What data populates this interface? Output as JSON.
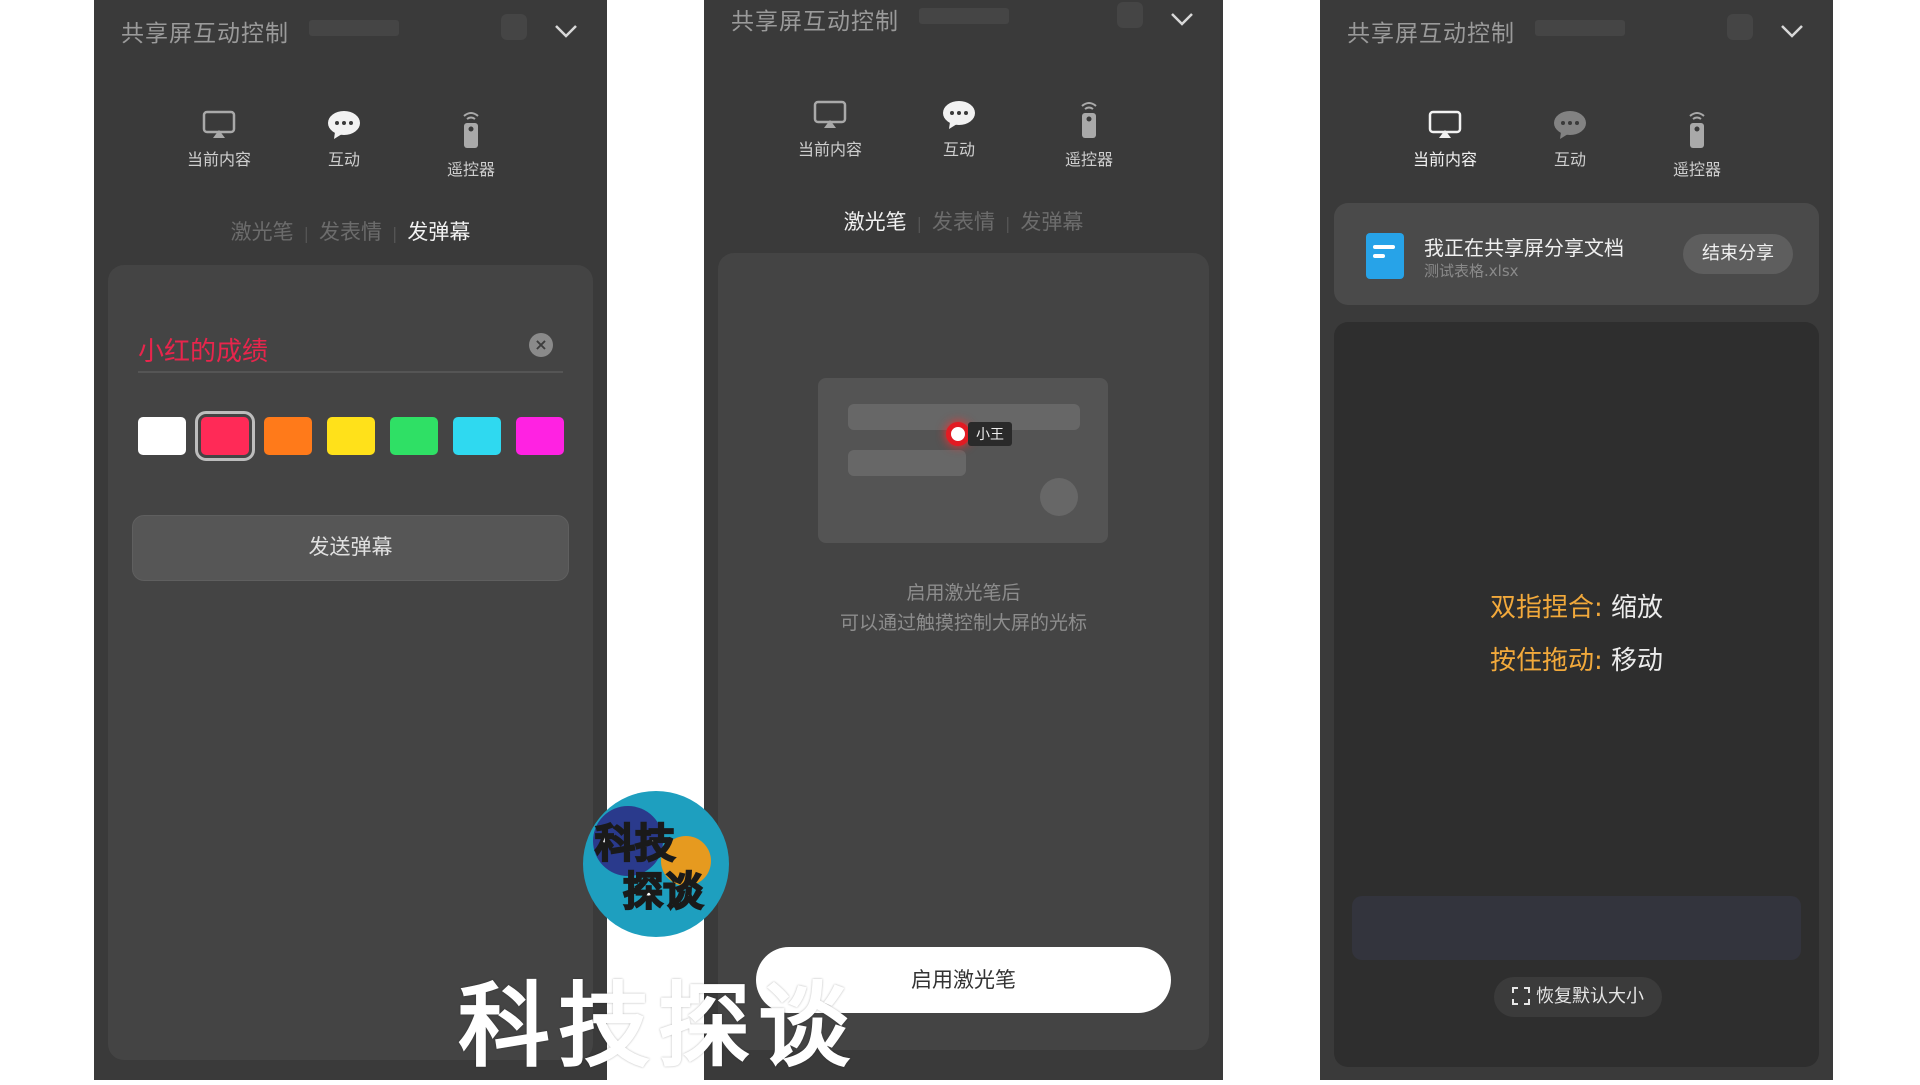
{
  "header": {
    "title": "共享屏互动控制"
  },
  "main_tabs": {
    "current": "当前内容",
    "interact": "互动",
    "remote": "遥控器"
  },
  "sub_tabs": {
    "laser": "激光笔",
    "emoji": "发表情",
    "danmu": "发弹幕"
  },
  "danmu": {
    "input_value": "小红的成绩",
    "send_label": "发送弹幕",
    "colors": [
      "#ffffff",
      "#ff2a57",
      "#ff7a1a",
      "#ffe11a",
      "#2fe065",
      "#2fd9f0",
      "#ff22e2"
    ],
    "selected_color_index": 1
  },
  "laser": {
    "user_tag": "小王",
    "hint_line1": "启用激光笔后",
    "hint_line2": "可以通过触摸控制大屏的光标",
    "enable_label": "启用激光笔"
  },
  "share": {
    "title": "我正在共享屏分享文档",
    "file": "测试表格.xlsx",
    "end_label": "结束分享",
    "pinch_key": "双指捏合:",
    "pinch_val": "缩放",
    "drag_key": "按住拖动:",
    "drag_val": "移动",
    "restore_label": "恢复默认大小"
  },
  "overlay": {
    "badge_line1": "科技",
    "badge_line2": "探谈",
    "watermark": "科技探谈"
  },
  "colors": {
    "panel_bg": "#3a3a3a",
    "accent_orange": "#f2a93b",
    "danmu_red": "#e8254c",
    "doc_blue": "#27a3e8"
  }
}
